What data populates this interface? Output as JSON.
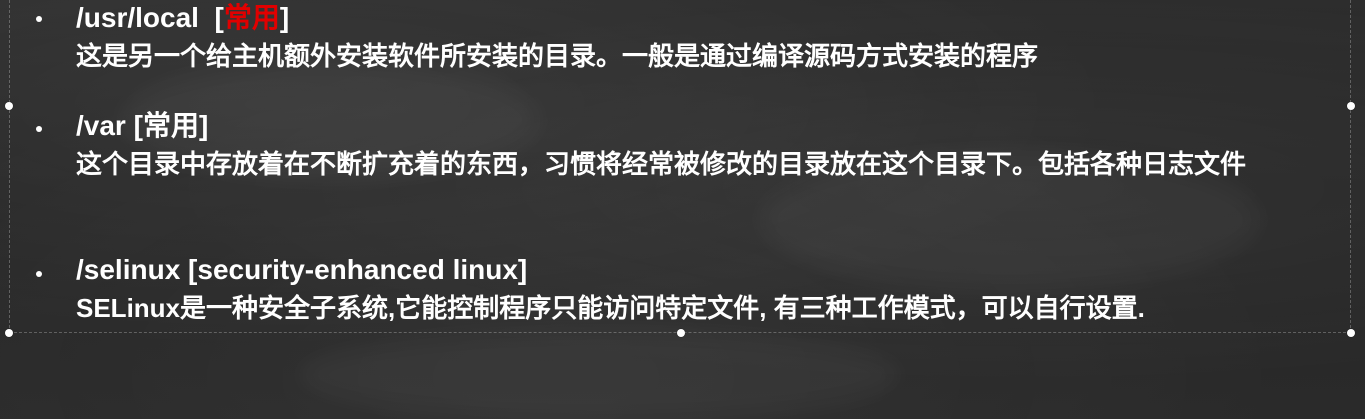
{
  "entries": [
    {
      "path": "/usr/local",
      "tag_open": "[",
      "tag": "常用",
      "tag_close": "]",
      "description": "这是另一个给主机额外安装软件所安装的目录。一般是通过编译源码方式安装的程序"
    },
    {
      "path": "/var",
      "tag_open": " [",
      "tag": "常用",
      "tag_close": "]",
      "description": "这个目录中存放着在不断扩充着的东西，习惯将经常被修改的目录放在这个目录下。包括各种日志文件"
    },
    {
      "path": "/selinux",
      "tag_open": " [",
      "tag": "security-enhanced linux",
      "tag_close": "]",
      "description": "SELinux是一种安全子系统,它能控制程序只能访问特定文件, 有三种工作模式，可以自行设置."
    }
  ],
  "colors": {
    "background": "#2a2a2a",
    "text": "#ffffff",
    "highlight": "#e10000"
  }
}
